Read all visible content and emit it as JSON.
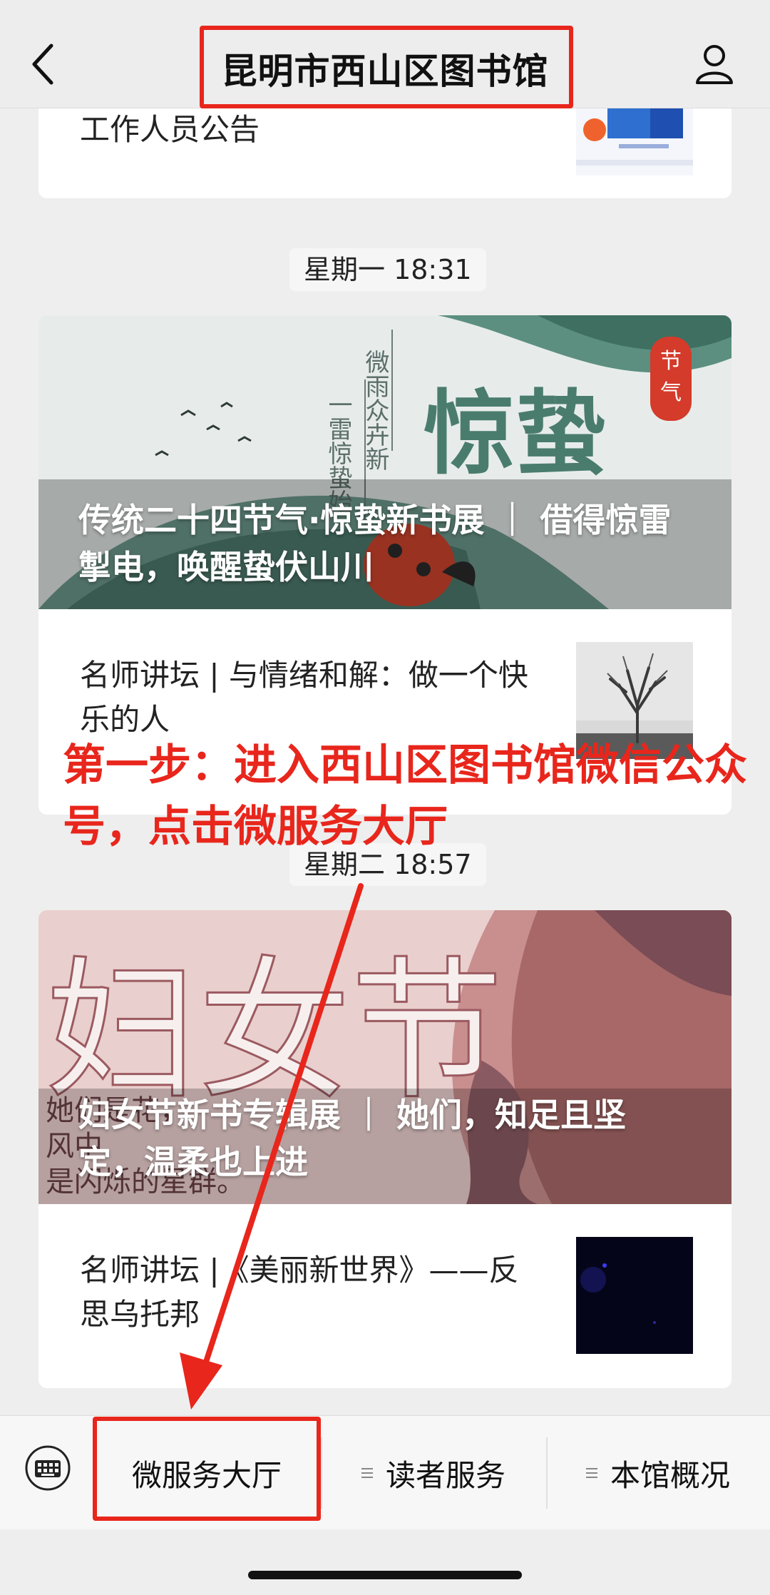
{
  "nav": {
    "title": "昆明市西山区图书馆"
  },
  "feed": {
    "prev_item_title": "工作人员公告",
    "groups": [
      {
        "time": "星期一 18:31",
        "cover_title": "传统二十四节气·惊蛰新书展 ｜ 借得惊雷掣电，唤醒蛰伏山川",
        "cover_art": {
          "big": "惊蛰",
          "seal": "节气",
          "poem_col1": "微雨众卉新",
          "poem_col2": "一雷惊蛰始"
        },
        "second_title": "名师讲坛 | 与情绪和解：做一个快乐的人"
      },
      {
        "time": "星期二 18:57",
        "cover_title": "妇女节新书专辑展 ｜ 她们，知足且坚定，温柔也上进",
        "cover_art": {
          "big": "妇女节",
          "side1": "她们是花，",
          "side2": "风中",
          "side3": "是闪烁的星群。"
        },
        "second_title": "名师讲坛 |《美丽新世界》——反思乌托邦"
      }
    ]
  },
  "annotation": {
    "text": "第一步：进入西山区图书馆微信公众号，点击微服务大厅"
  },
  "bottom_menu": {
    "items": [
      "微服务大厅",
      "读者服务",
      "本馆概况"
    ]
  },
  "colors": {
    "highlight": "#e8261c",
    "background": "#eeeeee"
  },
  "icons": [
    "back-arrow-icon",
    "user-icon",
    "keyboard-icon",
    "menu-lines-icon"
  ]
}
